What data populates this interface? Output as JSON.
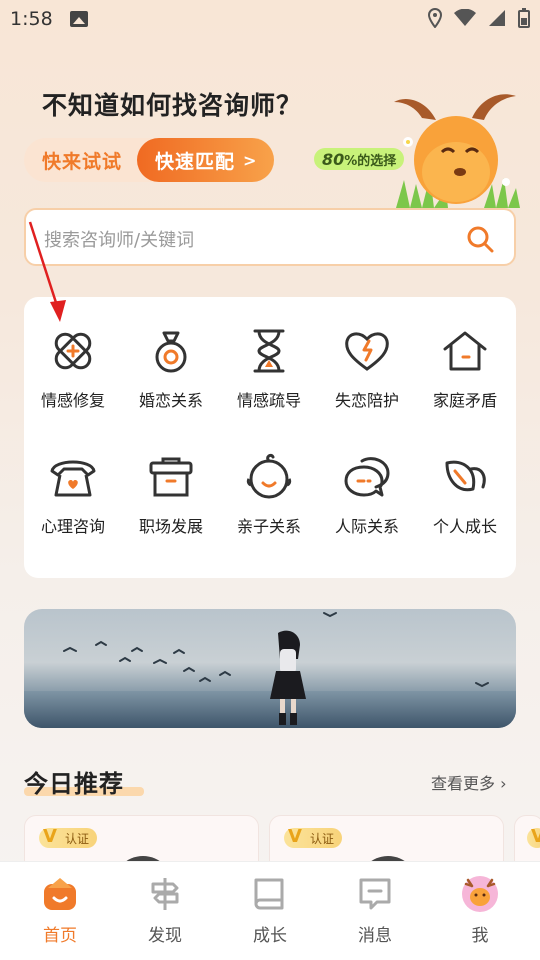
{
  "status": {
    "time": "1:58"
  },
  "hero": {
    "title": "不知道如何找咨询师？",
    "try_label": "快来试试",
    "match_label": "快速匹配",
    "badge_num": "80",
    "badge_text": "%的选择"
  },
  "search": {
    "placeholder": "搜索咨询师/关键词"
  },
  "categories": [
    {
      "label": "情感修复",
      "icon": "bandage-icon"
    },
    {
      "label": "婚恋关系",
      "icon": "ring-icon"
    },
    {
      "label": "情感疏导",
      "icon": "hourglass-icon"
    },
    {
      "label": "失恋陪护",
      "icon": "broken-heart-icon"
    },
    {
      "label": "家庭矛盾",
      "icon": "house-icon"
    },
    {
      "label": "心理咨询",
      "icon": "telephone-icon"
    },
    {
      "label": "职场发展",
      "icon": "briefcase-icon"
    },
    {
      "label": "亲子关系",
      "icon": "baby-face-icon"
    },
    {
      "label": "人际关系",
      "icon": "chat-bubbles-icon"
    },
    {
      "label": "个人成长",
      "icon": "leaf-icon"
    }
  ],
  "recommend": {
    "title": "今日推荐",
    "more": "查看更多 ›",
    "cert_label": "认证"
  },
  "nav": [
    {
      "label": "首页",
      "icon": "home-icon",
      "active": true
    },
    {
      "label": "发现",
      "icon": "signpost-icon"
    },
    {
      "label": "成长",
      "icon": "book-icon"
    },
    {
      "label": "消息",
      "icon": "message-icon"
    },
    {
      "label": "我",
      "icon": "deer-avatar-icon"
    }
  ],
  "colors": {
    "accent": "#f07a2a",
    "accent_light": "#f8a24a"
  }
}
